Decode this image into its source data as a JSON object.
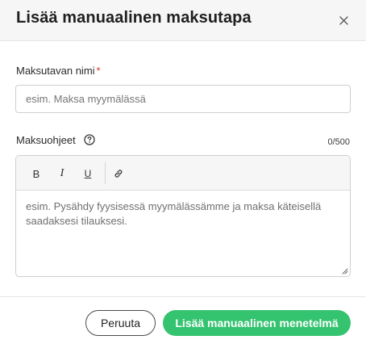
{
  "dialog": {
    "title": "Lisää manuaalinen maksutapa",
    "close_icon": "close-icon"
  },
  "name_field": {
    "label": "Maksutavan nimi",
    "required_mark": "*",
    "placeholder": "esim. Maksa myymälässä",
    "value": ""
  },
  "instructions_field": {
    "label": "Maksuohjeet",
    "help_icon": "help-circle-icon",
    "char_count": "0/500",
    "toolbar": {
      "bold": "B",
      "italic": "I",
      "underline": "U",
      "link_icon": "link-icon"
    },
    "placeholder": "esim. Pysähdy fyysisessä myymälässämme ja maksa käteisellä saadaksesi tilauksesi."
  },
  "footer": {
    "cancel_label": "Peruuta",
    "submit_label": "Lisää manuaalinen menetelmä"
  },
  "colors": {
    "primary": "#34c36f",
    "required": "#e0342d",
    "header_bg": "#f6f6f6"
  }
}
